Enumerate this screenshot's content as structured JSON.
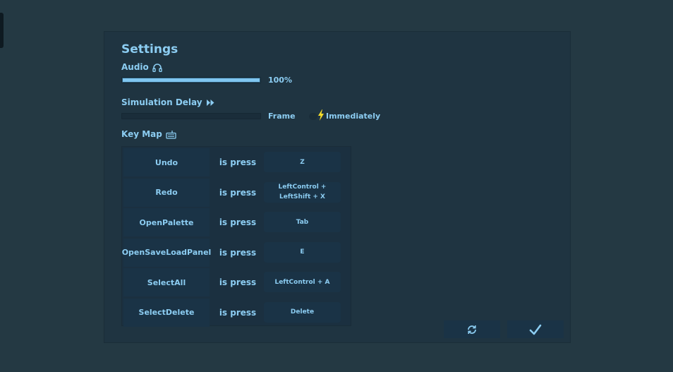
{
  "settings": {
    "title": "Settings",
    "audio": {
      "label": "Audio",
      "icon": "headphones-icon",
      "level_fraction": 1.0,
      "value_text": "100%"
    },
    "simulation_delay": {
      "label": "Simulation Delay",
      "icon": "fast-forward-icon",
      "level_fraction": 0.0,
      "value_text": "Frame",
      "immediate_label": "Immediately",
      "immediate_icon": "lightning-icon"
    },
    "key_map": {
      "label": "Key Map",
      "icon": "keyboard-icon",
      "rows": [
        {
          "action": "Undo",
          "relation": "is press",
          "key": "Z"
        },
        {
          "action": "Redo",
          "relation": "is press",
          "key": "LeftControl + LeftShift + X"
        },
        {
          "action": "OpenPalette",
          "relation": "is press",
          "key": "Tab"
        },
        {
          "action": "OpenSaveLoadPanel",
          "relation": "is press",
          "key": "E"
        },
        {
          "action": "SelectAll",
          "relation": "is press",
          "key": "LeftControl + A"
        },
        {
          "action": "SelectDelete",
          "relation": "is press",
          "key": "Delete"
        }
      ]
    },
    "buttons": {
      "reset_icon": "refresh-icon",
      "confirm_icon": "checkmark-icon"
    }
  },
  "colors": {
    "background": "#243943",
    "panel": "#1f3441",
    "accent": "#8ccdf2",
    "slider_fill": "#7fc6f0",
    "bolt": "#f5dd2a"
  }
}
